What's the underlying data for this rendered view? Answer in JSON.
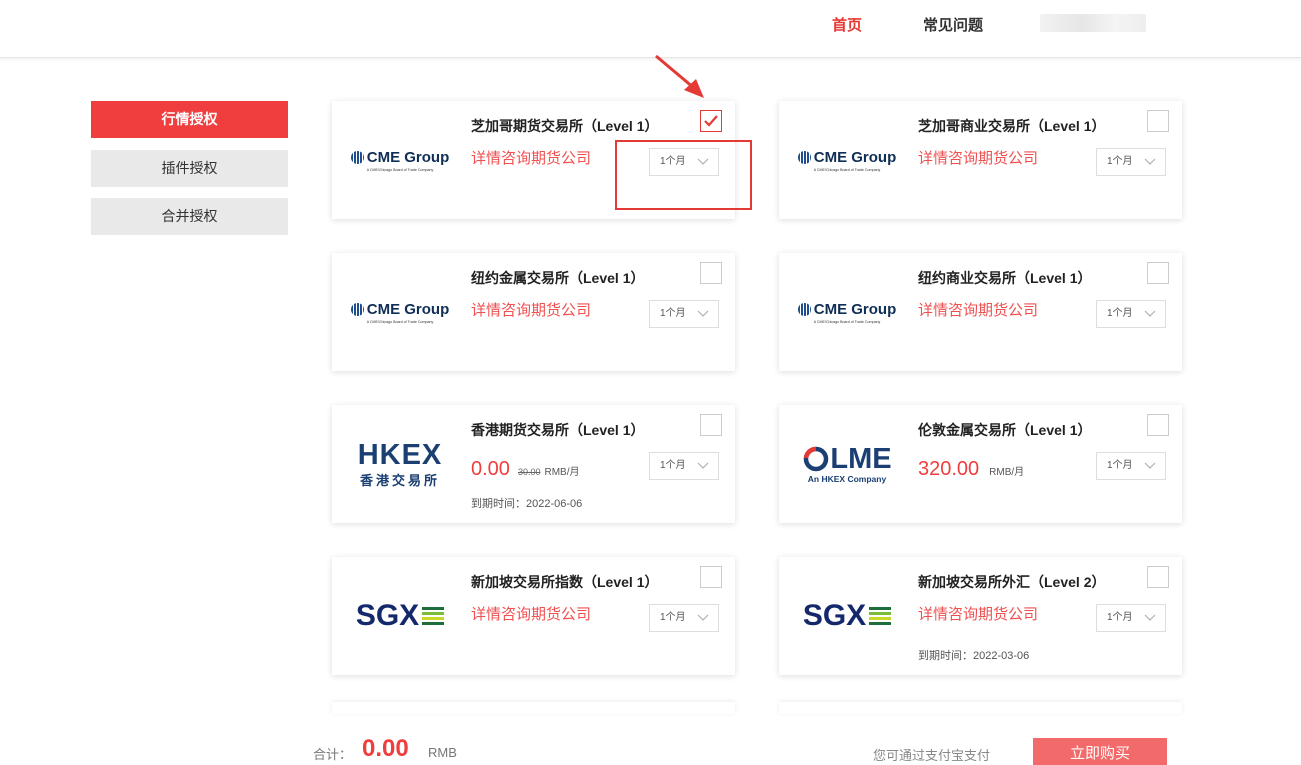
{
  "nav": {
    "home": "首页",
    "faq": "常见问题"
  },
  "sidebar": {
    "items": [
      {
        "label": "行情授权",
        "active": true
      },
      {
        "label": "插件授权",
        "active": false
      },
      {
        "label": "合并授权",
        "active": false
      }
    ]
  },
  "cards": [
    {
      "title": "芝加哥期货交易所（Level 1）",
      "logo": "cme-logo",
      "logo_name": "CME Group",
      "logo_tagline": "A CME/Chicago Board of Trade Company",
      "consult": "详情咨询期货公司",
      "duration": "1个月",
      "checked": true
    },
    {
      "title": "芝加哥商业交易所（Level 1）",
      "logo": "cme-logo",
      "logo_name": "CME Group",
      "logo_tagline": "A CME/Chicago Board of Trade Company",
      "consult": "详情咨询期货公司",
      "duration": "1个月",
      "checked": false
    },
    {
      "title": "纽约金属交易所（Level 1）",
      "logo": "cme-logo",
      "logo_name": "CME Group",
      "logo_tagline": "A CME/Chicago Board of Trade Company",
      "consult": "详情咨询期货公司",
      "duration": "1个月",
      "checked": false
    },
    {
      "title": "纽约商业交易所（Level 1）",
      "logo": "cme-logo",
      "logo_name": "CME Group",
      "logo_tagline": "A CME/Chicago Board of Trade Company",
      "consult": "详情咨询期货公司",
      "duration": "1个月",
      "checked": false
    },
    {
      "title": "香港期货交易所（Level 1）",
      "logo": "hkex-logo",
      "logo_name": "HKEX",
      "logo_tagline": "香港交易所",
      "price": "0.00",
      "price_old": "30.00",
      "price_unit": "RMB/月",
      "expire": "到期时间：2022-06-06",
      "duration": "1个月",
      "checked": false
    },
    {
      "title": "伦敦金属交易所（Level 1）",
      "logo": "lme-logo",
      "logo_name": "LME",
      "logo_tagline": "An HKEX Company",
      "price": "320.00",
      "price_unit": "RMB/月",
      "duration": "1个月",
      "checked": false
    },
    {
      "title": "新加坡交易所指数（Level 1）",
      "logo": "sgx-logo",
      "logo_name": "SGX",
      "consult": "详情咨询期货公司",
      "duration": "1个月",
      "checked": false
    },
    {
      "title": "新加坡交易所外汇（Level 2）",
      "logo": "sgx-logo",
      "logo_name": "SGX",
      "consult": "详情咨询期货公司",
      "expire": "到期时间：2022-03-06",
      "duration": "1个月",
      "checked": false
    }
  ],
  "footer": {
    "total_label": "合计：",
    "total_value": "0.00",
    "currency": "RMB",
    "pay_hint": "您可通过支付宝支付",
    "buy_label": "立即购买"
  },
  "colors": {
    "accent": "#f03e3e",
    "consult": "#f05050",
    "buy_button": "#f26a6a",
    "sidebar_inactive": "#e9e9e9"
  }
}
